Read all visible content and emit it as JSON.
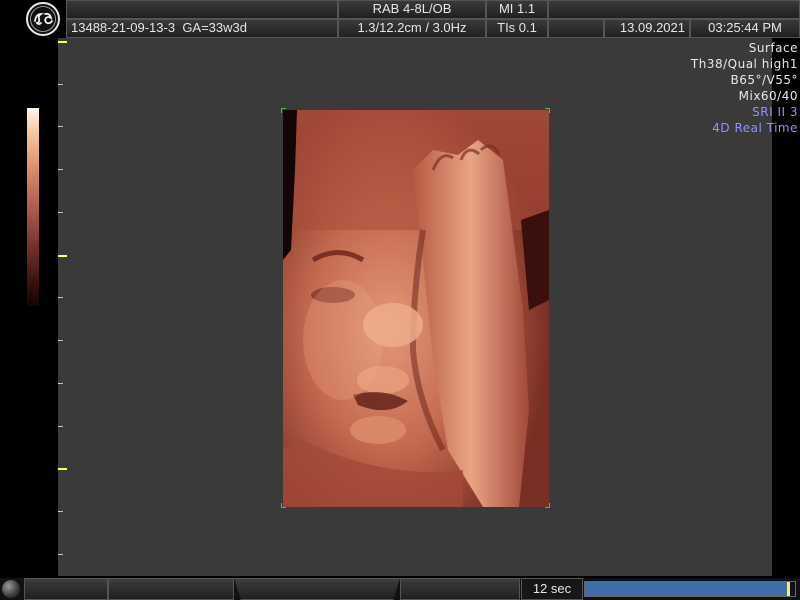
{
  "header": {
    "patient_id": "13488-21-09-13-3",
    "gestational_age": "GA=33w3d",
    "probe": "RAB 4-8L/OB",
    "depth_freq": "1.3/12.2cm / 3.0Hz",
    "mi": "MI  1.1",
    "tis": "TIs  0.1",
    "date": "13.09.2021",
    "time": "03:25:44 PM"
  },
  "logo": {
    "icon": "ge-logo-icon"
  },
  "settings": [
    {
      "text": "Surface",
      "highlight": false
    },
    {
      "text": "Th38/Qual high1",
      "highlight": false
    },
    {
      "text": "B65°/V55°",
      "highlight": false
    },
    {
      "text": "Mix60/40",
      "highlight": false
    },
    {
      "text": "SRI II 3",
      "highlight": true
    },
    {
      "text": "4D Real Time",
      "highlight": true
    }
  ],
  "colors": {
    "highlight": "#8f92ff",
    "render_base": "#b85a44",
    "progress": "#3e6fa8"
  },
  "footer": {
    "timer": "12 sec",
    "progress_fraction": 0.97
  }
}
